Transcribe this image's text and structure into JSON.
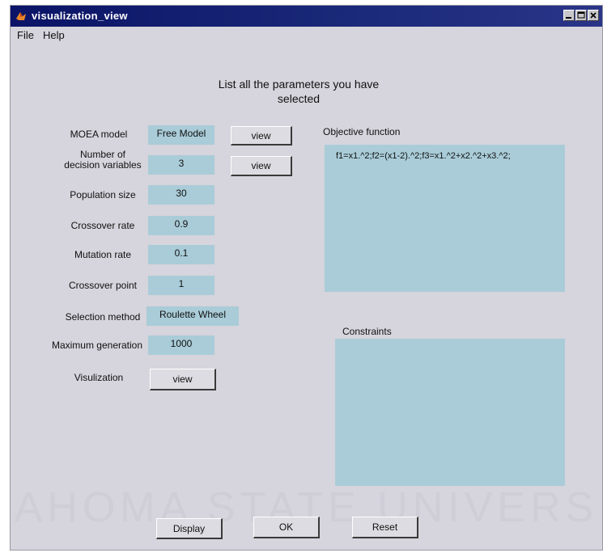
{
  "window": {
    "title": "visualization_view"
  },
  "menu": {
    "file": "File",
    "help": "Help"
  },
  "heading": {
    "line1": "List all the parameters you have",
    "line2": "selected"
  },
  "params": {
    "moea_model": {
      "label": "MOEA model",
      "value": "Free Model",
      "button": "view"
    },
    "num_vars": {
      "label_line1": "Number of",
      "label_line2": "decision variables",
      "value": "3",
      "button": "view"
    },
    "population": {
      "label": "Population size",
      "value": "30"
    },
    "crossover_rate": {
      "label": "Crossover rate",
      "value": "0.9"
    },
    "mutation_rate": {
      "label": "Mutation rate",
      "value": "0.1"
    },
    "crossover_point": {
      "label": "Crossover point",
      "value": "1"
    },
    "selection": {
      "label": "Selection method",
      "value": "Roulette Wheel"
    },
    "max_gen": {
      "label": "Maximum generation",
      "value": "1000"
    },
    "visualization": {
      "label": "Visulization",
      "button": "view"
    }
  },
  "objective": {
    "label": "Objective function",
    "text": "f1=x1.^2;f2=(x1-2).^2;f3=x1.^2+x2.^2+x3.^2;"
  },
  "constraints": {
    "label": "Constraints",
    "text": ""
  },
  "buttons": {
    "display": "Display",
    "ok": "OK",
    "reset": "Reset"
  },
  "watermark": "AHOMA STATE UNIVERS",
  "colors": {
    "titlebar": "#0b1466",
    "field_bg": "#a9ccd8",
    "window_bg": "#d6d4dc"
  }
}
